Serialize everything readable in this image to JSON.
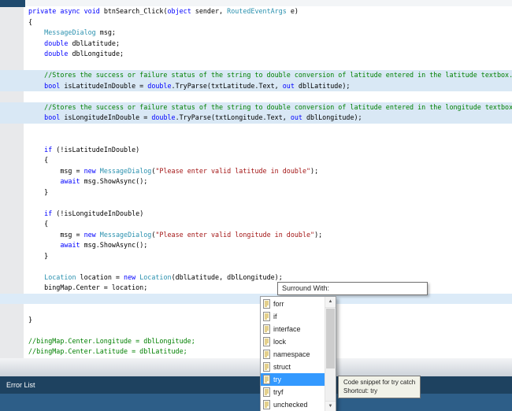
{
  "editor": {
    "background": "#ffffff",
    "gutter_color": "#e8e9eb",
    "comment_block_highlight": "#d9e8f5",
    "lines": [
      {
        "hl": 0,
        "segs": [
          [
            "k",
            "private"
          ],
          [
            "p",
            " "
          ],
          [
            "k",
            "async"
          ],
          [
            "p",
            " "
          ],
          [
            "k",
            "void"
          ],
          [
            "p",
            " btnSearch_Click("
          ],
          [
            "k",
            "object"
          ],
          [
            "p",
            " sender, "
          ],
          [
            "t",
            "RoutedEventArgs"
          ],
          [
            "p",
            " e)"
          ]
        ]
      },
      {
        "hl": 0,
        "segs": [
          [
            "p",
            "{"
          ]
        ]
      },
      {
        "hl": 0,
        "segs": [
          [
            "p",
            "    "
          ],
          [
            "t",
            "MessageDialog"
          ],
          [
            "p",
            " msg;"
          ]
        ]
      },
      {
        "hl": 0,
        "segs": [
          [
            "p",
            "    "
          ],
          [
            "k",
            "double"
          ],
          [
            "p",
            " dblLatitude;"
          ]
        ]
      },
      {
        "hl": 0,
        "segs": [
          [
            "p",
            "    "
          ],
          [
            "k",
            "double"
          ],
          [
            "p",
            " dblLongitude;"
          ]
        ]
      },
      {
        "hl": 0,
        "segs": []
      },
      {
        "hl": 1,
        "segs": [
          [
            "c",
            "    //Stores the success or failure status of the string to double conversion of latitude entered in the latitude textbox."
          ]
        ]
      },
      {
        "hl": 1,
        "segs": [
          [
            "p",
            "    "
          ],
          [
            "k",
            "bool"
          ],
          [
            "p",
            " isLatitudeInDouble = "
          ],
          [
            "k",
            "double"
          ],
          [
            "p",
            ".TryParse(txtLatitude.Text, "
          ],
          [
            "k",
            "out"
          ],
          [
            "p",
            " dblLatitude);"
          ]
        ]
      },
      {
        "hl": 0,
        "segs": []
      },
      {
        "hl": 1,
        "segs": [
          [
            "c",
            "    //Stores the success or failure status of the string to double conversion of latitude entered in the longitude textbox."
          ]
        ]
      },
      {
        "hl": 1,
        "segs": [
          [
            "p",
            "    "
          ],
          [
            "k",
            "bool"
          ],
          [
            "p",
            " isLongitudeInDouble = "
          ],
          [
            "k",
            "double"
          ],
          [
            "p",
            ".TryParse(txtLongitude.Text, "
          ],
          [
            "k",
            "out"
          ],
          [
            "p",
            " dblLongitude);"
          ]
        ]
      },
      {
        "hl": 0,
        "segs": []
      },
      {
        "hl": 0,
        "segs": []
      },
      {
        "hl": 0,
        "segs": [
          [
            "p",
            "    "
          ],
          [
            "k",
            "if"
          ],
          [
            "p",
            " (!isLatitudeInDouble)"
          ]
        ]
      },
      {
        "hl": 0,
        "segs": [
          [
            "p",
            "    {"
          ]
        ]
      },
      {
        "hl": 0,
        "segs": [
          [
            "p",
            "        msg = "
          ],
          [
            "k",
            "new"
          ],
          [
            "p",
            " "
          ],
          [
            "t",
            "MessageDialog"
          ],
          [
            "p",
            "("
          ],
          [
            "s",
            "\"Please enter valid latitude in double\""
          ],
          [
            "p",
            ");"
          ]
        ]
      },
      {
        "hl": 0,
        "segs": [
          [
            "p",
            "        "
          ],
          [
            "k",
            "await"
          ],
          [
            "p",
            " msg.ShowAsync();"
          ]
        ]
      },
      {
        "hl": 0,
        "segs": [
          [
            "p",
            "    }"
          ]
        ]
      },
      {
        "hl": 0,
        "segs": []
      },
      {
        "hl": 0,
        "segs": [
          [
            "p",
            "    "
          ],
          [
            "k",
            "if"
          ],
          [
            "p",
            " (!isLongitudeInDouble)"
          ]
        ]
      },
      {
        "hl": 0,
        "segs": [
          [
            "p",
            "    {"
          ]
        ]
      },
      {
        "hl": 0,
        "segs": [
          [
            "p",
            "        msg = "
          ],
          [
            "k",
            "new"
          ],
          [
            "p",
            " "
          ],
          [
            "t",
            "MessageDialog"
          ],
          [
            "p",
            "("
          ],
          [
            "s",
            "\"Please enter valid longitude in double\""
          ],
          [
            "p",
            ");"
          ]
        ]
      },
      {
        "hl": 0,
        "segs": [
          [
            "p",
            "        "
          ],
          [
            "k",
            "await"
          ],
          [
            "p",
            " msg.ShowAsync();"
          ]
        ]
      },
      {
        "hl": 0,
        "segs": [
          [
            "p",
            "    }"
          ]
        ]
      },
      {
        "hl": 0,
        "segs": []
      },
      {
        "hl": 0,
        "segs": [
          [
            "p",
            "    "
          ],
          [
            "t",
            "Location"
          ],
          [
            "p",
            " location = "
          ],
          [
            "k",
            "new"
          ],
          [
            "p",
            " "
          ],
          [
            "t",
            "Location"
          ],
          [
            "p",
            "(dblLatitude, dblLongitude);"
          ]
        ]
      },
      {
        "hl": 0,
        "segs": [
          [
            "p",
            "    bingMap.Center = location;"
          ]
        ]
      },
      {
        "hl": 2,
        "segs": []
      },
      {
        "hl": 0,
        "segs": []
      },
      {
        "hl": 0,
        "segs": [
          [
            "p",
            "}"
          ]
        ]
      },
      {
        "hl": 0,
        "segs": []
      },
      {
        "hl": 0,
        "segs": [
          [
            "c",
            "//bingMap.Center.Longitude = dblLongitude;"
          ]
        ]
      },
      {
        "hl": 0,
        "segs": [
          [
            "c",
            "//bingMap.Center.Latitude = dblLatitude;"
          ]
        ]
      }
    ]
  },
  "syntax_colors": {
    "keyword": "#0000ff",
    "type": "#2b91af",
    "string": "#a31515",
    "comment": "#008000",
    "plain": "#000000"
  },
  "surround_popup": {
    "label": "Surround With:"
  },
  "snippet_list": {
    "selection_color": "#3399ff",
    "items": [
      {
        "label": "forr",
        "selected": false
      },
      {
        "label": "if",
        "selected": false
      },
      {
        "label": "interface",
        "selected": false
      },
      {
        "label": "lock",
        "selected": false
      },
      {
        "label": "namespace",
        "selected": false
      },
      {
        "label": "struct",
        "selected": false
      },
      {
        "label": "try",
        "selected": true
      },
      {
        "label": "tryf",
        "selected": false
      },
      {
        "label": "unchecked",
        "selected": false
      }
    ]
  },
  "tooltip": {
    "line1": "Code snippet for try catch",
    "line2": "Shortcut: try"
  },
  "bottom": {
    "error_list_label": "Error List",
    "error_bar_color": "#1e4260",
    "status_bar_color": "#2d5e88"
  }
}
